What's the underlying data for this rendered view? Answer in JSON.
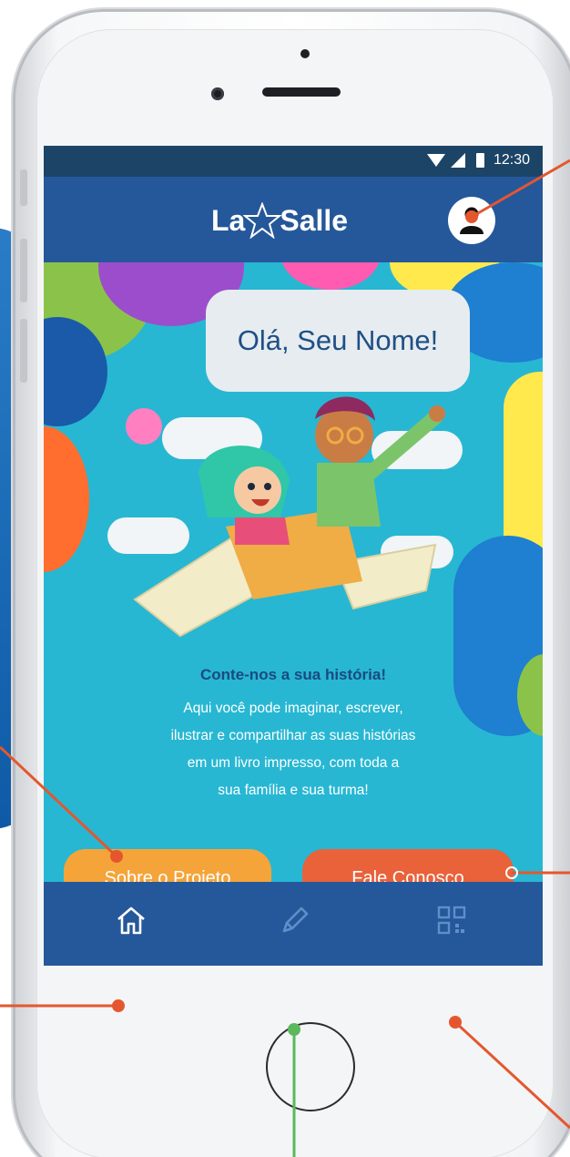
{
  "status_bar": {
    "time": "12:30"
  },
  "header": {
    "logo_text_left": "La",
    "logo_text_right": "Salle",
    "profile_icon": "user-icon"
  },
  "hero": {
    "greeting": "Olá, Seu Nome!",
    "story_title": "Conte-nos a sua história!",
    "story_body": "Aqui você pode imaginar, escrever,\nilustrar e compartilhar as suas histórias\nem um livro impresso, com toda a\nsua família e sua turma!"
  },
  "buttons": {
    "about_label": "Sobre o Projeto",
    "contact_label": "Fale Conosco"
  },
  "nav": {
    "items": [
      {
        "icon": "home-icon"
      },
      {
        "icon": "pencil-icon"
      },
      {
        "icon": "qr-code-icon"
      }
    ]
  },
  "colors": {
    "header_blue": "#25589a",
    "status_bar": "#1c4467",
    "screen_teal": "#27b7d3",
    "about_orange": "#f5a43a",
    "contact_red": "#e9623a",
    "callout_orange": "#e4572e",
    "callout_green": "#5cb85c"
  }
}
